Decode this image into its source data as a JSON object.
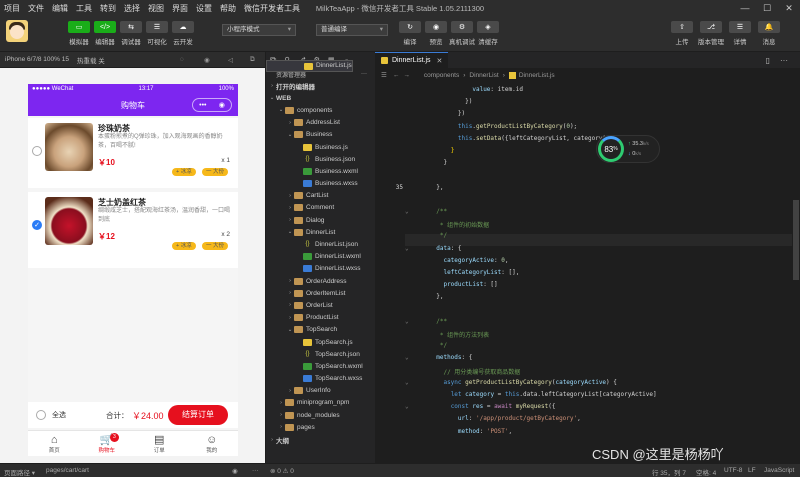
{
  "menubar": {
    "items": [
      "项目",
      "文件",
      "编辑",
      "工具",
      "转到",
      "选择",
      "视图",
      "界面",
      "设置",
      "帮助",
      "微信开发者工具"
    ],
    "window_title": "MilkTeaApp - 微信开发者工具 Stable 1.05.2111300"
  },
  "toolbar": {
    "left_buttons": [
      {
        "label": "模拟器",
        "glyph": "▭"
      },
      {
        "label": "编辑器",
        "glyph": "</>"
      },
      {
        "label": "调试器",
        "glyph": "⇆"
      },
      {
        "label": "可视化",
        "glyph": "☰"
      },
      {
        "label": "云开发",
        "glyph": "☁"
      }
    ],
    "mode_select": "小程序模式",
    "compile_select": "普通编译",
    "mid_buttons": [
      {
        "label": "编译",
        "glyph": "↻"
      },
      {
        "label": "预览",
        "glyph": "◉"
      },
      {
        "label": "真机调试",
        "glyph": "⚙"
      },
      {
        "label": "清缓存",
        "glyph": "◈"
      }
    ],
    "right_buttons": [
      {
        "label": "上传",
        "glyph": "⇧"
      },
      {
        "label": "版本管理",
        "glyph": "⎇"
      },
      {
        "label": "详情",
        "glyph": "☰"
      },
      {
        "label": "消息",
        "glyph": "🔔"
      }
    ]
  },
  "simulator": {
    "device": "iPhone 6/7/8 100% 15",
    "reload": "热重载 关",
    "status": {
      "carrier": "●●●●● WeChat",
      "time": "13:17",
      "battery": "100%"
    },
    "nav_title": "购物车",
    "capsule_dots": "•••",
    "items": [
      {
        "title": "珍珠奶茶",
        "desc": "本蛋粉煎煮的Q弹珍珠，加入观海观画的香醇奶茶，百喝不腻!",
        "currency": "￥",
        "price": "10",
        "qty": "x 1",
        "checked": false,
        "checkmark": "",
        "tag1": "+ 冰凉",
        "tag2": "一 大份"
      },
      {
        "title": "芝士奶盖红茶",
        "desc": "绸缎咸芝士，搭配观海红茶汤，温润香甜，一口喝到底",
        "currency": "￥",
        "price": "12",
        "qty": "x 2",
        "checked": true,
        "checkmark": "✓",
        "tag1": "+ 冰凉",
        "tag2": "一 大份"
      }
    ],
    "footer": {
      "select_all": "全选",
      "total_label": "合计：",
      "currency": "￥",
      "total": "24.00",
      "checkout": "结算订单"
    },
    "tabs": [
      {
        "label": "首页",
        "icon": "⌂",
        "active": false
      },
      {
        "label": "购物车",
        "icon": "🛒",
        "active": true,
        "badge": "3"
      },
      {
        "label": "订单",
        "icon": "▤",
        "active": false
      },
      {
        "label": "我的",
        "icon": "☺",
        "active": false
      }
    ]
  },
  "explorer": {
    "title": "资源管理器",
    "more": "···",
    "rows": [
      {
        "depth": 0,
        "arrow": "›",
        "type": "none",
        "name": "打开的编辑器"
      },
      {
        "depth": 0,
        "arrow": "⌄",
        "type": "none",
        "name": "WEB"
      },
      {
        "depth": 1,
        "arrow": "⌄",
        "type": "folder",
        "name": "components"
      },
      {
        "depth": 2,
        "arrow": "›",
        "type": "folder",
        "name": "AddressList"
      },
      {
        "depth": 2,
        "arrow": "⌄",
        "type": "folder",
        "name": "Business"
      },
      {
        "depth": 3,
        "arrow": "",
        "type": "js",
        "name": "Business.js"
      },
      {
        "depth": 3,
        "arrow": "",
        "type": "json",
        "name": "Business.json"
      },
      {
        "depth": 3,
        "arrow": "",
        "type": "wxml",
        "name": "Business.wxml"
      },
      {
        "depth": 3,
        "arrow": "",
        "type": "wxss",
        "name": "Business.wxss"
      },
      {
        "depth": 2,
        "arrow": "›",
        "type": "folder",
        "name": "CartList"
      },
      {
        "depth": 2,
        "arrow": "›",
        "type": "folder",
        "name": "Comment"
      },
      {
        "depth": 2,
        "arrow": "›",
        "type": "folder",
        "name": "Dialog"
      },
      {
        "depth": 2,
        "arrow": "⌄",
        "type": "folder",
        "name": "DinnerList"
      },
      {
        "depth": 3,
        "arrow": "",
        "type": "js",
        "name": "DinnerList.js",
        "selected": true
      },
      {
        "depth": 3,
        "arrow": "",
        "type": "json",
        "name": "DinnerList.json"
      },
      {
        "depth": 3,
        "arrow": "",
        "type": "wxml",
        "name": "DinnerList.wxml"
      },
      {
        "depth": 3,
        "arrow": "",
        "type": "wxss",
        "name": "DinnerList.wxss"
      },
      {
        "depth": 2,
        "arrow": "›",
        "type": "folder",
        "name": "OrderAddress"
      },
      {
        "depth": 2,
        "arrow": "›",
        "type": "folder",
        "name": "OrderItemList"
      },
      {
        "depth": 2,
        "arrow": "›",
        "type": "folder",
        "name": "OrderList"
      },
      {
        "depth": 2,
        "arrow": "›",
        "type": "folder",
        "name": "ProductList"
      },
      {
        "depth": 2,
        "arrow": "⌄",
        "type": "folder",
        "name": "TopSearch"
      },
      {
        "depth": 3,
        "arrow": "",
        "type": "js",
        "name": "TopSearch.js"
      },
      {
        "depth": 3,
        "arrow": "",
        "type": "json",
        "name": "TopSearch.json"
      },
      {
        "depth": 3,
        "arrow": "",
        "type": "wxml",
        "name": "TopSearch.wxml"
      },
      {
        "depth": 3,
        "arrow": "",
        "type": "wxss",
        "name": "TopSearch.wxss"
      },
      {
        "depth": 2,
        "arrow": "›",
        "type": "folder",
        "name": "UserInfo"
      },
      {
        "depth": 1,
        "arrow": "›",
        "type": "folder",
        "name": "miniprogram_npm"
      },
      {
        "depth": 1,
        "arrow": "›",
        "type": "folder",
        "name": "node_modules"
      },
      {
        "depth": 1,
        "arrow": "›",
        "type": "folder",
        "name": "pages"
      },
      {
        "depth": 0,
        "arrow": "›",
        "type": "none",
        "name": "大纲"
      }
    ]
  },
  "editor": {
    "tab": "DinnerList.js",
    "breadcrumb": [
      "components",
      "DinnerList",
      "DinnerList.js"
    ],
    "lines": [
      {
        "n": "",
        "fold": "",
        "html": "            <span class='v'>value</span>: item.id"
      },
      {
        "n": "",
        "fold": "",
        "html": "          })"
      },
      {
        "n": "",
        "fold": "",
        "html": "        })"
      },
      {
        "n": "",
        "fold": "",
        "html": "        <span class='k'>this</span>.<span class='f'>getProductListByCategory</span>(<span class='n'>0</span>);"
      },
      {
        "n": "",
        "fold": "",
        "html": "        <span class='k'>this</span>.<span class='f'>setData</span>({leftCategoryList, categoryActive: <span class='n'>0</span>});"
      },
      {
        "n": "",
        "fold": "",
        "html": "      <span class='y'>}</span>"
      },
      {
        "n": "",
        "fold": "",
        "html": "    }"
      },
      {
        "n": "",
        "fold": "",
        "html": ""
      },
      {
        "n": "35",
        "fold": "",
        "html": "  },"
      },
      {
        "n": "",
        "fold": "",
        "html": ""
      },
      {
        "n": "",
        "fold": "⌄",
        "html": "  <span class='c'>/**</span>"
      },
      {
        "n": "",
        "fold": "",
        "html": "  <span class='c'> * 组件的初始数据</span>"
      },
      {
        "n": "",
        "fold": "",
        "html": "  <span class='c'> */</span>"
      },
      {
        "n": "",
        "fold": "⌄",
        "html": "  <span class='v'>data</span>: {"
      },
      {
        "n": "",
        "fold": "",
        "html": "    <span class='v'>categoryActive</span>: <span class='n'>0</span>,"
      },
      {
        "n": "",
        "fold": "",
        "html": "    <span class='v'>leftCategoryList</span>: [],"
      },
      {
        "n": "",
        "fold": "",
        "html": "    <span class='v'>productList</span>: []"
      },
      {
        "n": "",
        "fold": "",
        "html": "  },"
      },
      {
        "n": "",
        "fold": "",
        "html": ""
      },
      {
        "n": "",
        "fold": "⌄",
        "html": "  <span class='c'>/**</span>"
      },
      {
        "n": "",
        "fold": "",
        "html": "  <span class='c'> * 组件的方法列表</span>"
      },
      {
        "n": "",
        "fold": "",
        "html": "  <span class='c'> */</span>"
      },
      {
        "n": "",
        "fold": "⌄",
        "html": "  <span class='v'>methods</span>: {"
      },
      {
        "n": "",
        "fold": "",
        "html": "    <span class='c'>// 用分类编号获取商品数据</span>"
      },
      {
        "n": "",
        "fold": "⌄",
        "html": "    <span class='k'>async</span> <span class='f'>getProductListByCategory</span>(<span class='v'>categoryActive</span>) {"
      },
      {
        "n": "",
        "fold": "",
        "html": "      <span class='k'>let</span> <span class='v'>category</span> = <span class='k'>this</span>.data.leftCategoryList[categoryActive]"
      },
      {
        "n": "",
        "fold": "⌄",
        "html": "      <span class='k'>const</span> <span class='v'>res</span> = <span class='p'>await</span> <span class='f'>myRequest</span>({"
      },
      {
        "n": "",
        "fold": "",
        "html": "        <span class='v'>url</span>: <span class='s'>'/app/product/getByCategory'</span>,"
      },
      {
        "n": "",
        "fold": "",
        "html": "        <span class='v'>method</span>: <span class='s'>'POST'</span>,"
      }
    ],
    "perf": {
      "pct": "83",
      "unit": "%",
      "up": "35.3",
      "up_unit": "k/s",
      "down": "0",
      "down_unit": "k/s"
    }
  },
  "statusbar": {
    "left1": "页面路径 ▾",
    "path": "pages/cart/cart",
    "errors": "⊗ 0 ⚠ 0",
    "position": "行 35，列 7",
    "spaces": "空格: 4",
    "encoding": "UTF-8",
    "eol": "LF",
    "lang": "JavaScript"
  },
  "watermark": "CSDN @这里是杨杨吖"
}
